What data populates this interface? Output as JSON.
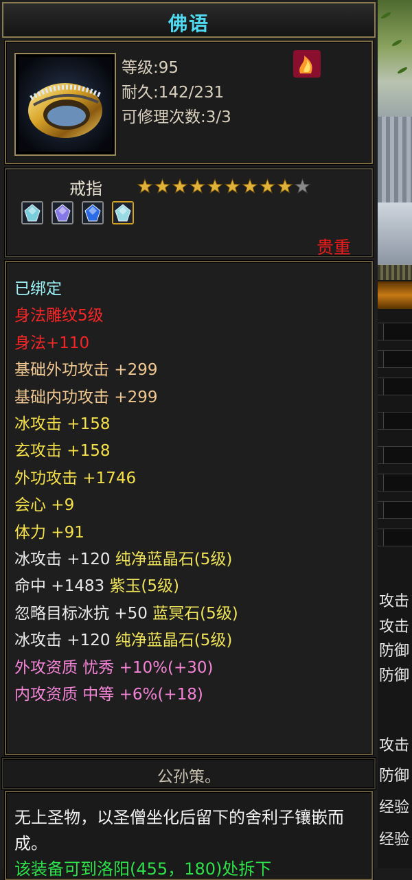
{
  "item": {
    "title": "佛语",
    "level_label": "等级:95",
    "durability_label": "耐久:142/231",
    "repair_label": "可修理次数:3/3",
    "type": "戒指",
    "stars_filled": 9,
    "stars_total": 10,
    "rarity": "贵重",
    "icon": "gold-ring-icon",
    "gem_type_icon": "flame-gem-icon",
    "sockets": [
      {
        "icon": "light-blue-gem-icon",
        "color": "#7fd6e6"
      },
      {
        "icon": "purple-gem-icon",
        "color": "#8a7cf0"
      },
      {
        "icon": "blue-gem-icon",
        "color": "#2e6ff0"
      },
      {
        "icon": "light-blue-gem-icon",
        "color": "#9fe4ee"
      }
    ]
  },
  "stats": [
    {
      "text": "已绑定",
      "color": "bound"
    },
    {
      "text": "身法雕纹5级",
      "color": "red"
    },
    {
      "text": "身法+110",
      "color": "red"
    },
    {
      "text": "基础外功攻击 +299",
      "color": "base"
    },
    {
      "text": "基础内功攻击 +299",
      "color": "base"
    },
    {
      "text": "冰攻击 +158",
      "color": "yellow"
    },
    {
      "text": "玄攻击 +158",
      "color": "yellow"
    },
    {
      "text": "外功攻击 +1746",
      "color": "yellow"
    },
    {
      "text": "会心 +9",
      "color": "yellow"
    },
    {
      "text": "体力 +91",
      "color": "yellow"
    },
    {
      "text": "冰攻击 +120",
      "gem": "纯净蓝晶石(5级)",
      "color": "white"
    },
    {
      "text": "命中 +1483",
      "gem": "紫玉(5级)",
      "color": "white"
    },
    {
      "text": "忽略目标冰抗 +50",
      "gem": "蓝冥石(5级)",
      "color": "white"
    },
    {
      "text": "冰攻击 +120",
      "gem": "纯净蓝晶石(5级)",
      "color": "white"
    },
    {
      "text": "外攻资质  忧秀 +10%(+30)",
      "color": "pink"
    },
    {
      "text": "内攻资质  中等 +6%(+18)",
      "color": "pink"
    }
  ],
  "owner": "公孙策。",
  "description": "无上圣物，以圣僧坐化后留下的舍利子镶嵌而成。",
  "description_green_partial": "该装备可到洛阳(455，180)处拆下",
  "scene_partial_labels": [
    "攻击",
    "攻击",
    "防御",
    "防御",
    "攻击",
    "防御",
    "经验",
    "经验"
  ],
  "colors": {
    "title": "#4fd8ee",
    "rarity": "#ee1b1b",
    "frame": "#7a6b45"
  }
}
